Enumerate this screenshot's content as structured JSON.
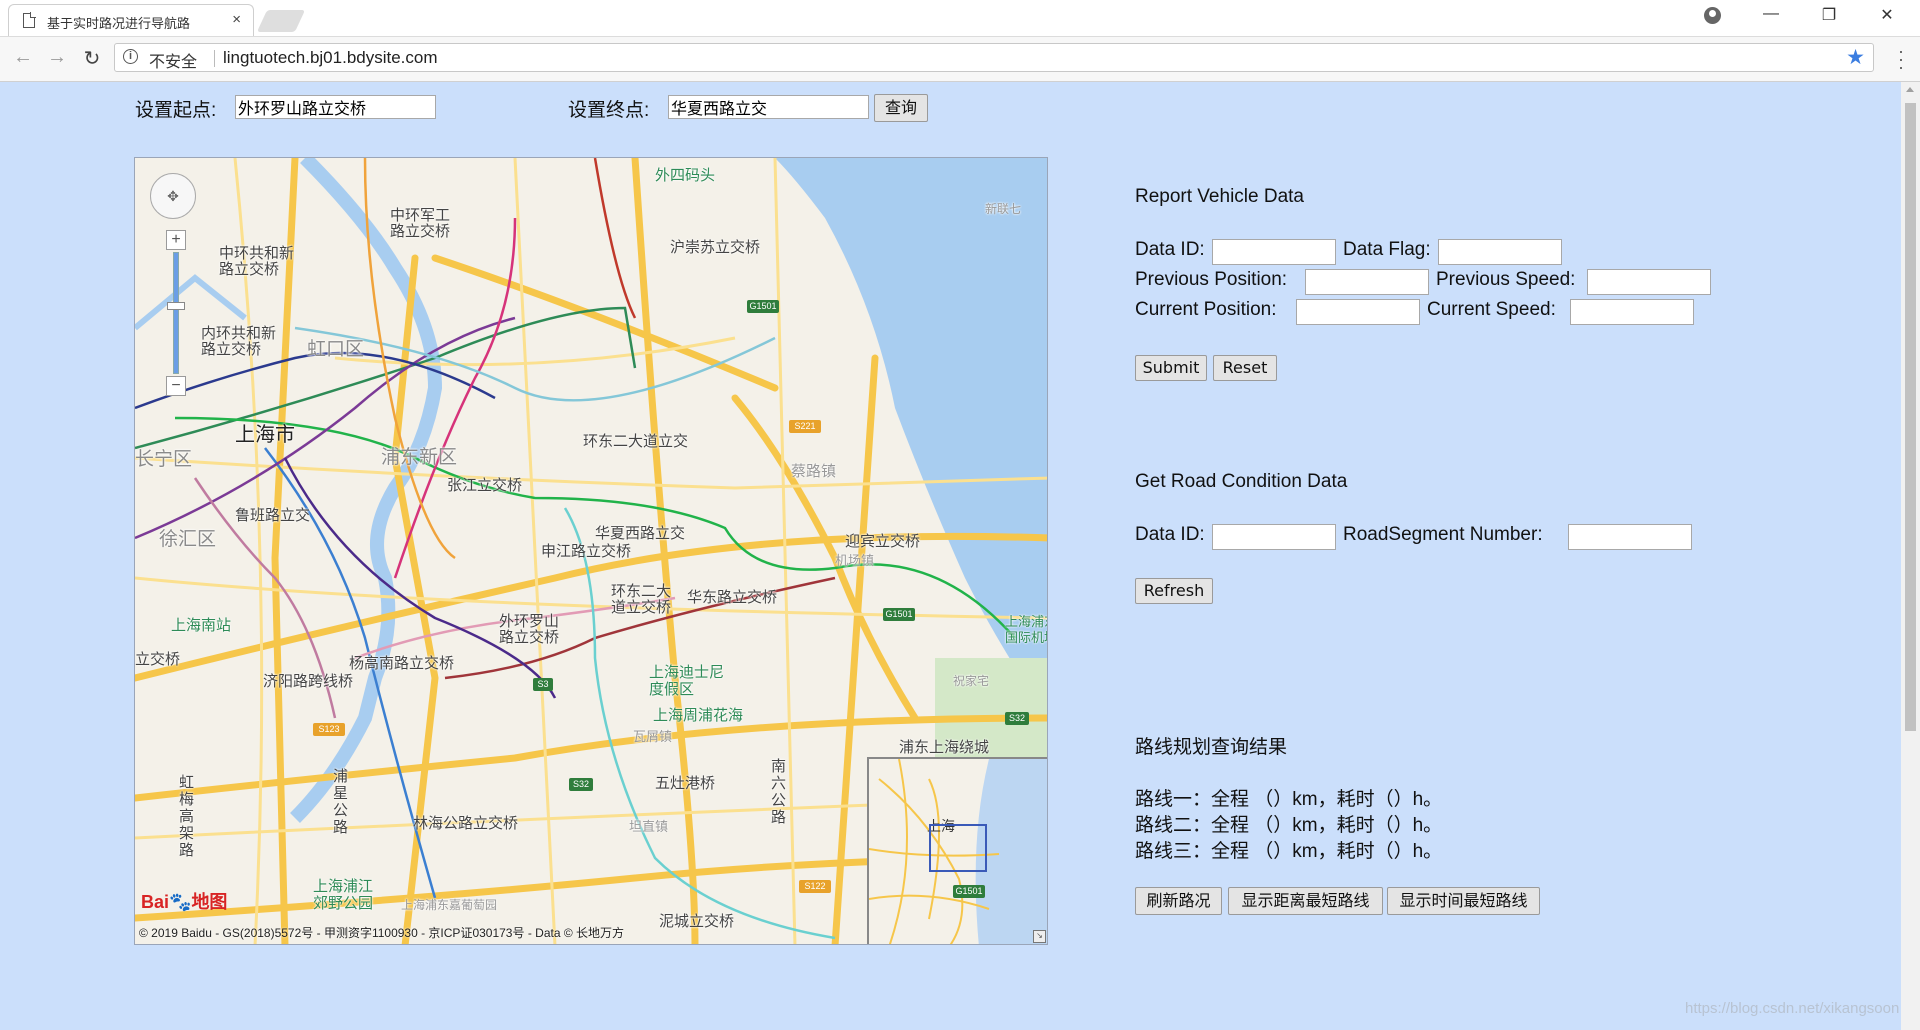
{
  "browser": {
    "tab_title": "基于实时路况进行导航路",
    "tab_close": "×",
    "insecure_label": "不安全",
    "url": "lingtuotech.bj01.bdysite.com",
    "window_controls": {
      "minimize": "—",
      "restore": "❐",
      "close": "✕"
    },
    "icons": [
      "page-icon",
      "account-icon",
      "back-arrow-icon",
      "forward-arrow-icon",
      "reload-icon",
      "info-icon",
      "bookmark-star-icon",
      "menu-icon"
    ]
  },
  "route_query": {
    "start_label": "设置起点:",
    "start_value": "外环罗山路立交桥",
    "end_label": "设置终点:",
    "end_value": "华夏西路立交",
    "query_button": "查询"
  },
  "report_vehicle": {
    "title": "Report Vehicle Data",
    "data_id_label": "Data ID:",
    "data_flag_label": "Data Flag:",
    "prev_position_label": "Previous Position:",
    "prev_speed_label": "Previous Speed:",
    "cur_position_label": "Current Position:",
    "cur_speed_label": "Current Speed:",
    "submit_button": "Submit",
    "reset_button": "Reset"
  },
  "road_condition": {
    "title": "Get Road Condition Data",
    "data_id_label": "Data ID:",
    "segment_label": "RoadSegment Number:",
    "refresh_button": "Refresh"
  },
  "route_result": {
    "title": "路线规划查询结果",
    "lines": [
      "路线一：全程 （）km，耗时（）h。",
      "路线二：全程 （）km，耗时（）h。",
      "路线三：全程 （）km，耗时（）h。"
    ],
    "buttons": [
      "刷新路况",
      "显示距离最短路线",
      "显示时间最短路线"
    ]
  },
  "map": {
    "labels": {
      "waisi": "外四码头",
      "zhonghuan_junggong": "中环军工\n路立交桥",
      "huchongsu": "沪崇苏立交桥",
      "zhonghuan_gonghe": "中环共和新\n路立交桥",
      "neihuan_gonghe": "内环共和新\n路立交桥",
      "hongkou": "虹口区",
      "shanghai": "上海市",
      "pudong": "浦东新区",
      "changning": "长宁区",
      "xuhui": "徐汇区",
      "lubanlu": "鲁班路立交",
      "zhangjiang": "张江立交桥",
      "huanerdadao": "环东二大道立交",
      "caijia": "蔡路镇",
      "huaxiaxilu": "华夏西路立交",
      "shenjiang": "申江路立交桥",
      "yingbin": "迎宾立交桥",
      "jichangzhen": "机场镇",
      "huanerdong": "环东二大\n道立交桥",
      "huadong": "华东路立交桥",
      "waihuan_luoshan": "外环罗山\n路立交桥",
      "shanghai_south": "上海南站",
      "jiyang": "济阳路跨线桥",
      "yanggao": "杨高南路立交桥",
      "disney": "上海迪士尼\n度假区",
      "zhoupu": "上海周浦花海",
      "guanzhen": "瓦屑镇",
      "airport": "上海浦东\n国际机场",
      "zhuyuan": "祝家宅",
      "pudongraocheng": "浦东上海绕城",
      "wuqigang": "五灶港桥",
      "nanliu": "南\n六\n公\n路",
      "hongmei": "虹\n梅\n高\n架\n路",
      "pujing": "浦\n星\n公\n路",
      "linhai": "林海公路立交桥",
      "tanzhi": "坦直镇",
      "pujiangpark": "上海浦江\n郊野公园",
      "ovshanghai": "上海",
      "xinhua": "新联七",
      "lijiaoqiao": "立交桥",
      "shanghai_pudong_tiny": "上海浦东嘉葡萄园",
      "niqiao": "泥城立交桥"
    },
    "shields": [
      "G1501",
      "S221",
      "G1501",
      "S3",
      "S123",
      "S32",
      "S32",
      "S122",
      "G1501"
    ],
    "controls": {
      "zoom_in": "+",
      "zoom_out": "−",
      "overview_toggle": "↘"
    },
    "logo_text_a": "Bai",
    "logo_text_b": "地图",
    "copyright": "© 2019 Baidu - GS(2018)5572号 - 甲测资字1100930 - 京ICP证030173号 - Data © 长地万方"
  },
  "watermark": "https://blog.csdn.net/xikangsoon"
}
